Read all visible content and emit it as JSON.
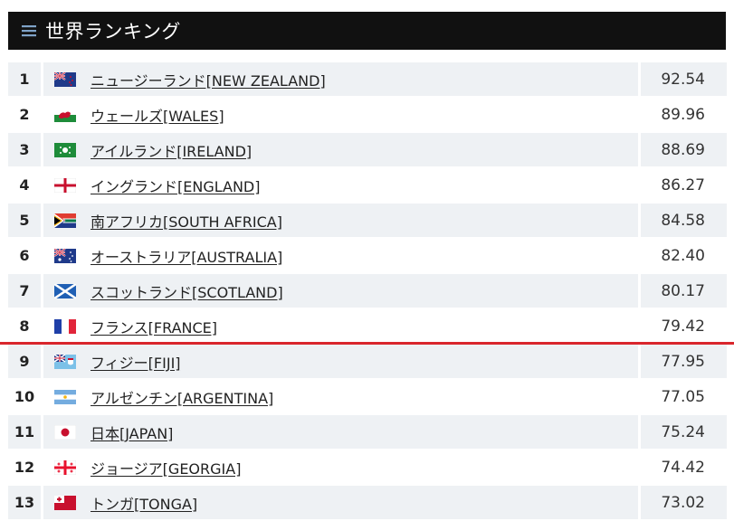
{
  "header": {
    "title": "世界ランキング",
    "menu_icon": "hamburger-icon"
  },
  "colors": {
    "header_bg": "#111111",
    "row_bg": "#eef1f4",
    "cutoff_line": "#d9262c"
  },
  "rankings": [
    {
      "rank": "1",
      "name": "ニュージーランド[NEW ZEALAND]",
      "points": "92.54",
      "flag": "new-zealand-flag-icon"
    },
    {
      "rank": "2",
      "name": "ウェールズ[WALES]",
      "points": "89.96",
      "flag": "wales-flag-icon"
    },
    {
      "rank": "3",
      "name": "アイルランド[IRELAND]",
      "points": "88.69",
      "flag": "ireland-flag-icon"
    },
    {
      "rank": "4",
      "name": "イングランド[ENGLAND]",
      "points": "86.27",
      "flag": "england-flag-icon"
    },
    {
      "rank": "5",
      "name": "南アフリカ[SOUTH AFRICA]",
      "points": "84.58",
      "flag": "south-africa-flag-icon"
    },
    {
      "rank": "6",
      "name": "オーストラリア[AUSTRALIA]",
      "points": "82.40",
      "flag": "australia-flag-icon"
    },
    {
      "rank": "7",
      "name": "スコットランド[SCOTLAND]",
      "points": "80.17",
      "flag": "scotland-flag-icon"
    },
    {
      "rank": "8",
      "name": "フランス[FRANCE]",
      "points": "79.42",
      "flag": "france-flag-icon"
    },
    {
      "rank": "9",
      "name": "フィジー[FIJI]",
      "points": "77.95",
      "flag": "fiji-flag-icon"
    },
    {
      "rank": "10",
      "name": "アルゼンチン[ARGENTINA]",
      "points": "77.05",
      "flag": "argentina-flag-icon"
    },
    {
      "rank": "11",
      "name": "日本[JAPAN]",
      "points": "75.24",
      "flag": "japan-flag-icon"
    },
    {
      "rank": "12",
      "name": "ジョージア[GEORGIA]",
      "points": "74.42",
      "flag": "georgia-flag-icon"
    },
    {
      "rank": "13",
      "name": "トンガ[TONGA]",
      "points": "73.02",
      "flag": "tonga-flag-icon"
    }
  ]
}
